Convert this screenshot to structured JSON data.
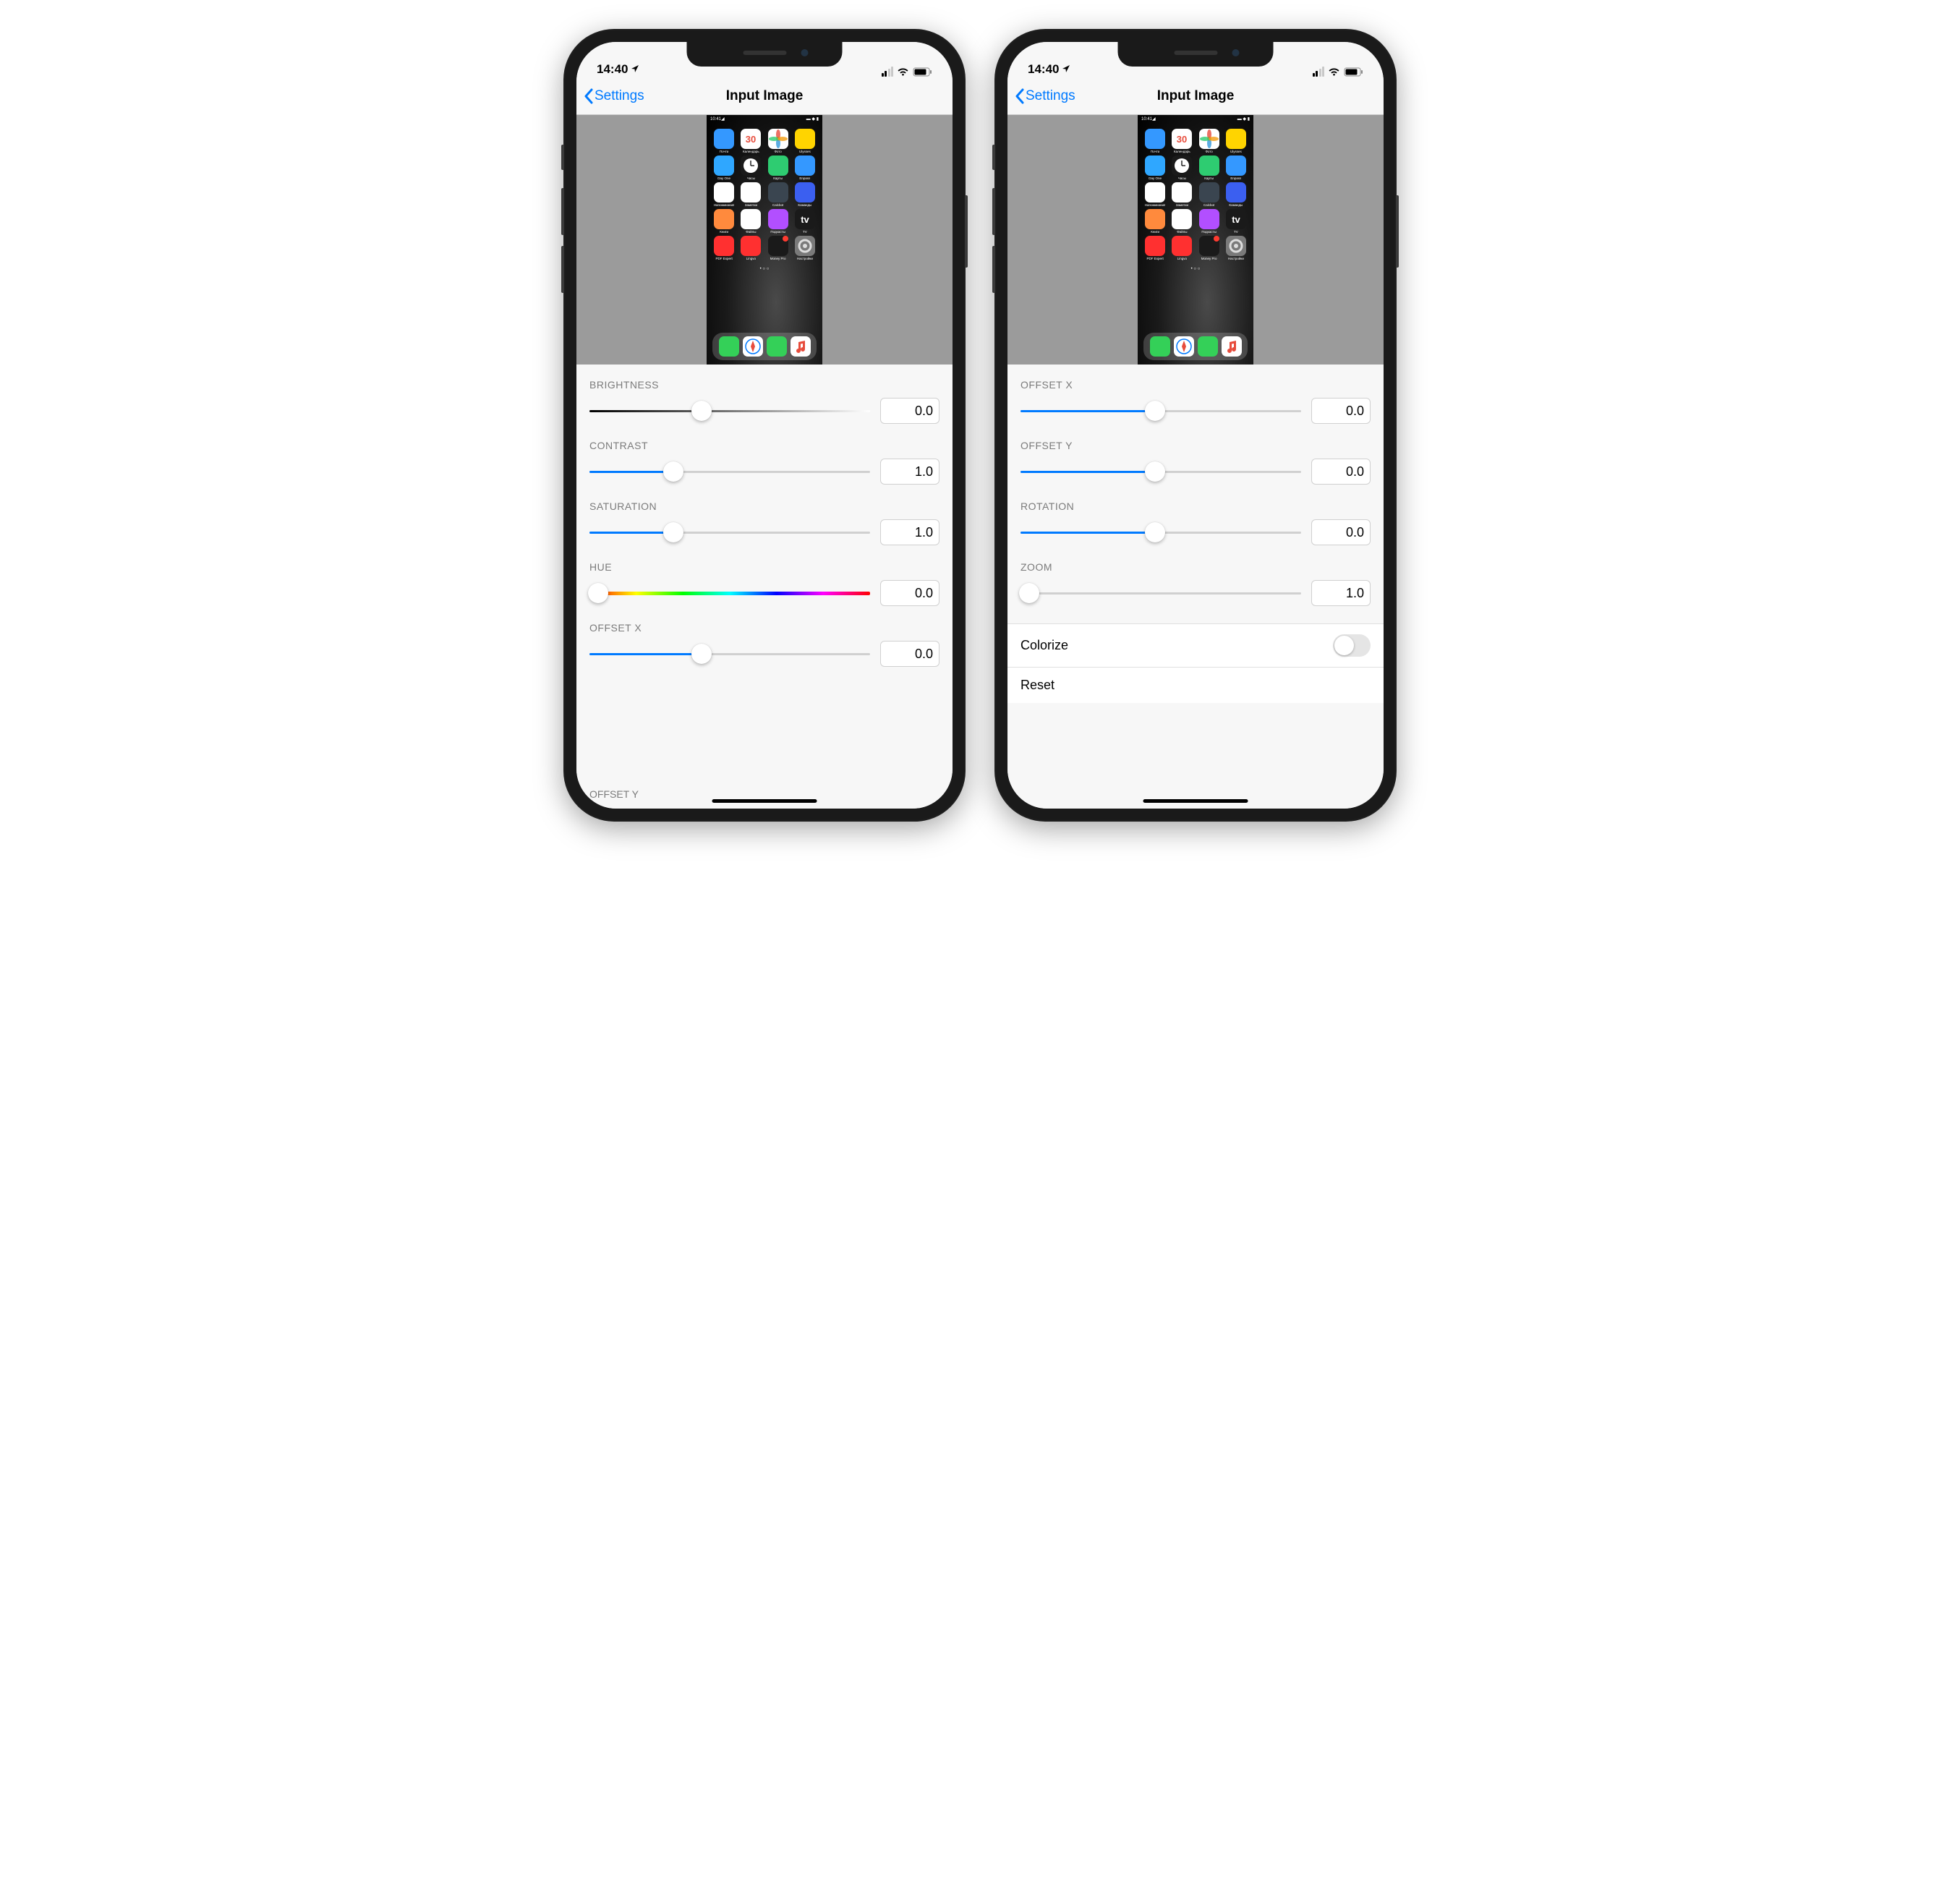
{
  "status": {
    "time": "14:40"
  },
  "nav": {
    "back": "Settings",
    "title": "Input Image"
  },
  "apps": {
    "r1": [
      {
        "label": "Почта",
        "c1": "#3498ff",
        "c2": "#1e6fe8"
      },
      {
        "label": "Календарь",
        "c1": "#ffffff",
        "c2": "#f0f0f0",
        "text": "30"
      },
      {
        "label": "Фото",
        "c1": "#ffffff",
        "c2": "#f0f0f0",
        "flower": true
      },
      {
        "label": "Ulysses",
        "c1": "#ffd400",
        "c2": "#f0b000"
      }
    ],
    "r2": [
      {
        "label": "Day One",
        "c1": "#2fa7ff",
        "c2": "#1e7fe0"
      },
      {
        "label": "Часы",
        "c1": "#1a1a1a",
        "c2": "#000000",
        "clock": true
      },
      {
        "label": "Карты",
        "c1": "#2ecc71",
        "c2": "#27ae60"
      },
      {
        "label": "Enpass",
        "c1": "#3498ff",
        "c2": "#1e6fe8"
      }
    ],
    "r3": [
      {
        "label": "Напоминания",
        "c1": "#ffffff",
        "c2": "#f0f0f0"
      },
      {
        "label": "Заметки",
        "c1": "#ffffff",
        "c2": "#fff3c0"
      },
      {
        "label": "Calcbot",
        "c1": "#3a4550",
        "c2": "#2a3540"
      },
      {
        "label": "Команды",
        "c1": "#3b5ff0",
        "c2": "#7b3ff0"
      }
    ],
    "r4": [
      {
        "label": "Книги",
        "c1": "#ff8a3d",
        "c2": "#ff6a1a"
      },
      {
        "label": "Файлы",
        "c1": "#ffffff",
        "c2": "#e8eef5"
      },
      {
        "label": "Подкасты",
        "c1": "#b24fff",
        "c2": "#8a2fe0"
      },
      {
        "label": "TV",
        "c1": "#1a1a1a",
        "c2": "#000000",
        "text": "tv"
      }
    ],
    "r5": [
      {
        "label": "PDF Expert",
        "c1": "#ff3030",
        "c2": "#d01010"
      },
      {
        "label": "Lingvo",
        "c1": "#ff3030",
        "c2": "#d01010"
      },
      {
        "label": "Money Pro",
        "c1": "#1a1a1a",
        "c2": "#000000",
        "badge": true
      },
      {
        "label": "Настройки",
        "c1": "#7a7a7a",
        "c2": "#5a5a5a",
        "gear": true
      }
    ],
    "dock": [
      {
        "c1": "#34d058",
        "c2": "#1fa845"
      },
      {
        "c1": "#ffffff",
        "c2": "#e8eef5",
        "compass": true
      },
      {
        "c1": "#34d058",
        "c2": "#1fa845"
      },
      {
        "c1": "#ffffff",
        "c2": "#f0f0f0",
        "music": true
      }
    ]
  },
  "left": {
    "sliders": [
      {
        "name": "BRIGHTNESS",
        "value": "0.0",
        "thumb": 40,
        "style": "grad-b"
      },
      {
        "name": "CONTRAST",
        "value": "1.0",
        "thumb": 30,
        "style": "blue"
      },
      {
        "name": "SATURATION",
        "value": "1.0",
        "thumb": 30,
        "style": "blue"
      },
      {
        "name": "HUE",
        "value": "0.0",
        "thumb": 3,
        "style": "grad-h"
      },
      {
        "name": "OFFSET X",
        "value": "0.0",
        "thumb": 40,
        "style": "blue"
      }
    ],
    "cut": "OFFSET Y"
  },
  "right": {
    "sliders": [
      {
        "name": "OFFSET X",
        "value": "0.0",
        "thumb": 48,
        "style": "blue"
      },
      {
        "name": "OFFSET Y",
        "value": "0.0",
        "thumb": 48,
        "style": "blue"
      },
      {
        "name": "ROTATION",
        "value": "0.0",
        "thumb": 48,
        "style": "blue"
      },
      {
        "name": "ZOOM",
        "value": "1.0",
        "thumb": 3,
        "style": "plain"
      }
    ],
    "rows": [
      {
        "label": "Colorize",
        "toggle": true
      },
      {
        "label": "Reset"
      }
    ]
  }
}
